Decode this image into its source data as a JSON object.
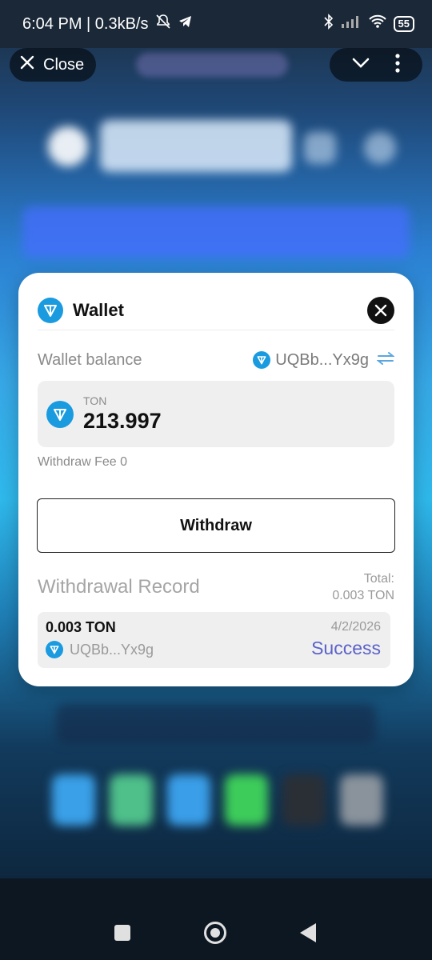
{
  "status_bar": {
    "time_speed": "6:04 PM | 0.3kB/s",
    "battery": "55"
  },
  "app_header": {
    "close_label": "Close"
  },
  "wallet_modal": {
    "title": "Wallet",
    "balance_label": "Wallet balance",
    "address_short": "UQBb...Yx9g",
    "currency": "TON",
    "amount": "213.997",
    "withdraw_fee_label": "Withdraw Fee 0",
    "withdraw_button": "Withdraw",
    "records_title": "Withdrawal Record",
    "total_label": "Total:",
    "total_value": "0.003 TON",
    "records": [
      {
        "amount": "0.003 TON",
        "date": "4/2/2026",
        "address": "UQBb...Yx9g",
        "status": "Success"
      }
    ]
  },
  "colors": {
    "ton_blue": "#1a9be0",
    "success": "#5b62c9"
  },
  "icons": [
    "close-icon",
    "chevron-down-icon",
    "more-icon",
    "ton-icon",
    "swap-icon",
    "bluetooth-icon",
    "wifi-icon",
    "signal-icon",
    "telegram-icon",
    "bell-off-icon"
  ]
}
